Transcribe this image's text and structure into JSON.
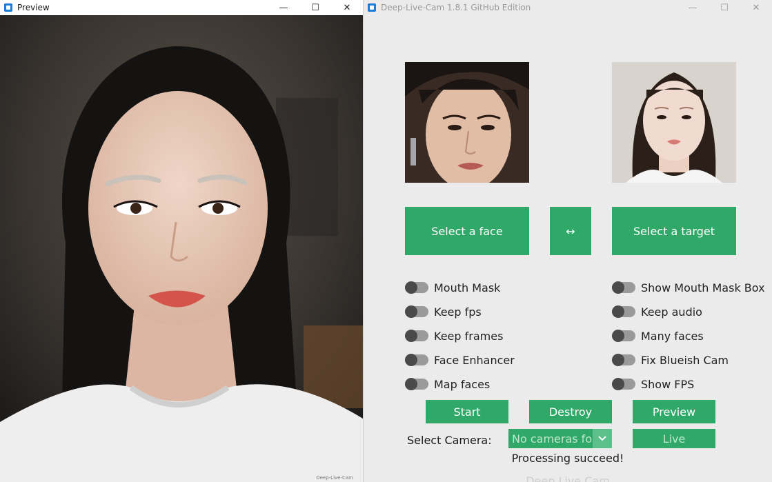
{
  "preview_window": {
    "title": "Preview",
    "controls": {
      "minimize": "—",
      "maximize": "☐",
      "close": "✕"
    },
    "watermark": "Deep-Live-Cam"
  },
  "main_window": {
    "title": "Deep-Live-Cam 1.8.1 GitHub Edition",
    "controls": {
      "minimize": "—",
      "maximize": "☐",
      "close": "✕"
    }
  },
  "buttons": {
    "select_face": "Select a face",
    "swap": "↔",
    "select_target": "Select a target",
    "start": "Start",
    "destroy": "Destroy",
    "preview": "Preview",
    "live": "Live"
  },
  "switches_left": [
    {
      "label": "Mouth Mask",
      "on": false
    },
    {
      "label": "Keep fps",
      "on": false
    },
    {
      "label": "Keep frames",
      "on": false
    },
    {
      "label": "Face Enhancer",
      "on": false
    },
    {
      "label": "Map faces",
      "on": false
    }
  ],
  "switches_right": [
    {
      "label": "Show Mouth Mask Box",
      "on": false
    },
    {
      "label": "Keep audio",
      "on": false
    },
    {
      "label": "Many faces",
      "on": false
    },
    {
      "label": "Fix Blueish Cam",
      "on": false
    },
    {
      "label": "Show FPS",
      "on": false
    }
  ],
  "camera": {
    "label": "Select Camera:",
    "selected": "No cameras found",
    "arrow_icon": "chevron-down-icon"
  },
  "status": "Processing succeed!",
  "footer": "Deep Live Cam",
  "colors": {
    "accent": "#2fa868",
    "window_bg": "#ebebeb",
    "switch_track": "#9a9a9a",
    "switch_knob": "#4a4a4a"
  }
}
